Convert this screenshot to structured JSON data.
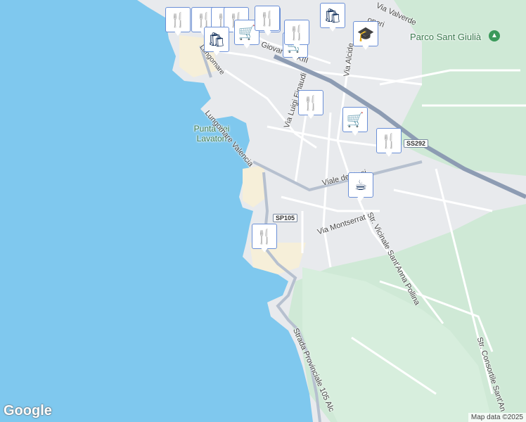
{
  "labels": {
    "park": "Parco Sant Giulià",
    "punta": "Punta dei Lavatori",
    "lungomare": "Lungomare Valencia",
    "via_valverde": "Via Valverde",
    "viale_xxiii": "Viale Giovanni XXIII",
    "via_alcide": "Via Alcide",
    "via_luigi": "Via Luigi Einaudi",
    "viale_resi": "Viale de   Resi",
    "via_montserrat": "Via Montserrat",
    "str_vicinale": "Str. Vicinale Sant'Anna Pollina",
    "strada_provinciale": "Strada Provinciale 105 Alc",
    "str_consortile": "Str. Consortile Sant'An",
    "via_bioperi": "operi",
    "via_top_left": "Lungomare"
  },
  "shields": {
    "ss292": "SS292",
    "sp105": "SP105"
  },
  "footer": {
    "google": "Google",
    "attribution": "Map data ©2025"
  },
  "pois": [
    {
      "type": "restaurant",
      "icon": "fork-knife-icon",
      "glyph": "🍴"
    },
    {
      "type": "restaurant",
      "icon": "fork-knife-icon",
      "glyph": "🍴"
    },
    {
      "type": "restaurant",
      "icon": "fork-knife-icon",
      "glyph": "🍴"
    },
    {
      "type": "restaurant",
      "icon": "fork-knife-icon",
      "glyph": "🍴"
    },
    {
      "type": "restaurant",
      "icon": "fork-knife-icon",
      "glyph": "🍴"
    },
    {
      "type": "shopping",
      "icon": "shopping-bag-icon",
      "glyph": "🛍"
    },
    {
      "type": "shopping",
      "icon": "shopping-bag-icon",
      "glyph": "🛍"
    },
    {
      "type": "grocery",
      "icon": "shopping-cart-icon",
      "glyph": "🛒"
    },
    {
      "type": "grocery",
      "icon": "shopping-cart-icon",
      "glyph": "🛒"
    },
    {
      "type": "grocery",
      "icon": "shopping-cart-icon",
      "glyph": "🛒"
    },
    {
      "type": "restaurant",
      "icon": "fork-knife-icon",
      "glyph": "🍴"
    },
    {
      "type": "restaurant",
      "icon": "fork-knife-icon",
      "glyph": "🍴"
    },
    {
      "type": "grocery",
      "icon": "shopping-cart-icon",
      "glyph": "🛒"
    },
    {
      "type": "restaurant",
      "icon": "fork-knife-icon",
      "glyph": "🍴"
    },
    {
      "type": "cafe",
      "icon": "coffee-cup-icon",
      "glyph": "☕"
    },
    {
      "type": "restaurant",
      "icon": "fork-knife-icon",
      "glyph": "🍴"
    },
    {
      "type": "school",
      "icon": "graduation-cap-icon",
      "glyph": "🎓"
    },
    {
      "type": "restaurant",
      "icon": "fork-knife-icon",
      "glyph": "🍴"
    }
  ],
  "colors": {
    "sea": "#7fc8ee",
    "land": "#eceef0",
    "park": "#cfe9d6",
    "beach": "#f6efd9",
    "road_major": "#8d9cb3",
    "road_minor": "#ffffff",
    "pin_border": "#6a8fd6",
    "pin_icon": "#0b2a57"
  }
}
